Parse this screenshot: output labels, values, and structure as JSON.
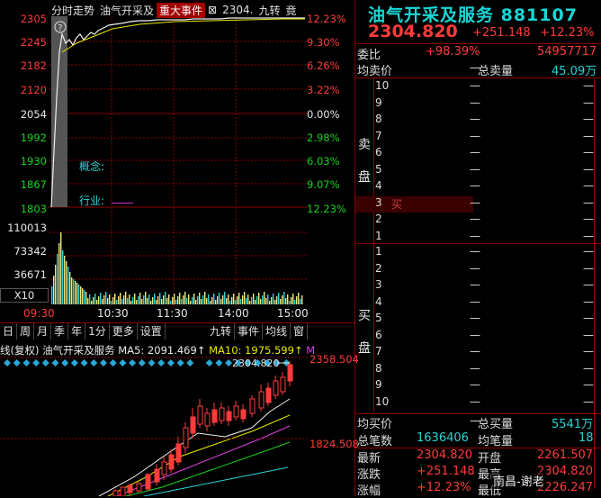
{
  "intraday": {
    "tabs": [
      "分时走势",
      "油气开采及",
      "重大事件",
      "⊠",
      "2304.",
      "九转",
      "竟"
    ],
    "price_labels": [
      "2305",
      "2245",
      "2182",
      "2120",
      "2054",
      "1992",
      "1930",
      "1867",
      "1803"
    ],
    "pct_labels": [
      "12.23%",
      "9.30%",
      "6.26%",
      "3.22%",
      "0.00%",
      "2.98%",
      "6.03%",
      "9.07%",
      "12.23%"
    ],
    "vol_labels": [
      "110013",
      "73342",
      "36671",
      "X10"
    ],
    "time_labels": [
      "09:30",
      "10:30",
      "11:30",
      "14:00",
      "15:00"
    ],
    "concept_label": "概念:",
    "industry_label": "行业:",
    "industry_value": "____",
    "question_icon": "?"
  },
  "kline": {
    "tabs": [
      "日",
      "周",
      "月",
      "季",
      "年",
      "1分",
      "更多",
      "设置",
      "九转",
      "事件",
      "均线",
      "窗"
    ],
    "legend_name": "线(复权)",
    "legend_title": "油气开采及服务",
    "ma5_label": "MA5: 2091.469↑",
    "ma10_label": "MA10: 1975.599↑",
    "ma_more": "M",
    "high_label": "2304.820",
    "axis_labels": [
      "2358.504",
      "1824.508"
    ]
  },
  "right": {
    "title": "油气开采及服务 881107",
    "price": "2304.820",
    "change": "+251.148",
    "change_pct": "+12.23%",
    "weibi_label": "委比",
    "weibi_value": "+98.39%",
    "weicha_value": "54957717",
    "avg_sell_label": "均卖价",
    "avg_sell_value": "—",
    "total_sell_label": "总卖量",
    "total_sell_value": "45.09万",
    "sell_side_label_1": "卖",
    "sell_side_label_2": "盘",
    "sell_levels": [
      "10",
      "9",
      "8",
      "7",
      "6",
      "5",
      "4",
      "3",
      "2",
      "1"
    ],
    "buy_marker": "买",
    "buy_side_label_1": "买",
    "buy_side_label_2": "盘",
    "buy_levels": [
      "1",
      "2",
      "3",
      "4",
      "5",
      "6",
      "7",
      "8",
      "9",
      "10"
    ],
    "dash": "—",
    "avg_buy_label": "均买价",
    "avg_buy_value": "—",
    "total_buy_label": "总买量",
    "total_buy_value": "5541万",
    "trades_label": "总笔数",
    "trades_value": "1636406",
    "avg_vol_label": "均笔量",
    "avg_vol_value": "18",
    "latest_label": "最新",
    "latest_value": "2304.820",
    "open_label": "开盘",
    "open_value": "2261.507",
    "chg_label": "涨跌",
    "chg_value": "+251.148",
    "high_label": "最高",
    "high_value": "2304.820",
    "chgpct_label": "涨幅",
    "chgpct_value": "+12.23%",
    "low_label": "最低",
    "low_value": "2226.247",
    "watermark": "南昌-谢老"
  }
}
